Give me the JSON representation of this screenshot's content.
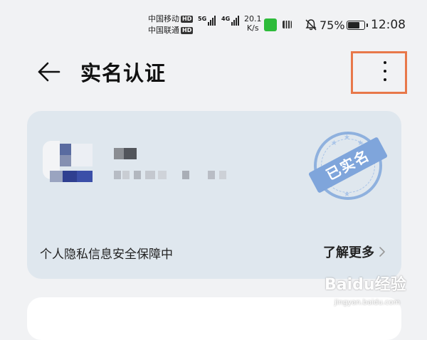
{
  "status_bar": {
    "carrier1": "中国移动",
    "carrier2": "中国联通",
    "hd_label": "HD",
    "network1": "5G",
    "network2": "4G",
    "speed_value": "20.1",
    "speed_unit": "K/s",
    "battery_percent": "75%",
    "battery_level": 0.75,
    "time": "12:08"
  },
  "header": {
    "title": "实名认证",
    "back_icon": "arrow-left-icon",
    "more_icon": "more-vertical-icon"
  },
  "card": {
    "stamp_text": "已实名",
    "privacy_text": "个人隐私信息安全保障中",
    "learn_more": "了解更多"
  },
  "watermark": {
    "text": "Baidu经验",
    "sub": "jingyan.baidu.com"
  },
  "colors": {
    "background": "#f1f2f4",
    "card": "#dfe7ee",
    "stamp": "#7fa5db",
    "highlight": "#e8784a"
  }
}
